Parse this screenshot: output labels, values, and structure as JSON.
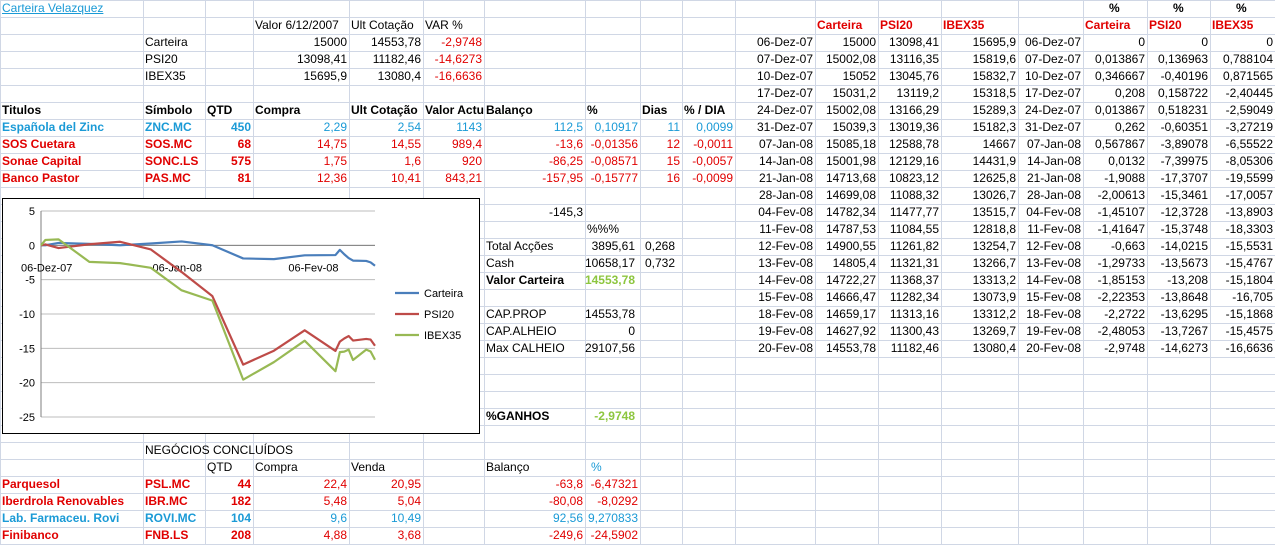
{
  "colors": {
    "red": "#e00000",
    "blue": "#1a9ad6",
    "green": "#8dc63f",
    "grid": "#d0d7e5"
  },
  "sheet": {
    "title": "Carteira Velazquez",
    "header": {
      "valor": "Valor 6/12/2007",
      "ult": "Ult Cotação",
      "var": "VAR %"
    },
    "summary": [
      {
        "label": "Carteira",
        "valor": "15000",
        "ult": "14553,78",
        "var": "-2,9748"
      },
      {
        "label": "PSI20",
        "valor": "13098,41",
        "ult": "11182,46",
        "var": "-14,6273"
      },
      {
        "label": "IBEX35",
        "valor": "15695,9",
        "ult": "13080,4",
        "var": "-16,6636"
      }
    ],
    "holdings_headers": [
      "Titulos",
      "Símbolo",
      "QTD",
      "Compra",
      "Ult Cotação",
      "Valor Actual",
      "Balanço",
      "%",
      "Dias",
      "% / DIA"
    ],
    "holdings": [
      {
        "name": "Española del Zinc",
        "symbol": "ZNC.MC",
        "qtd": "450",
        "compra": "2,29",
        "ult": "2,54",
        "valor": "1143",
        "balanco": "112,5",
        "pct": "0,10917",
        "dias": "11",
        "pctdia": "0,0099",
        "color": "blue"
      },
      {
        "name": "SOS Cuetara",
        "symbol": "SOS.MC",
        "qtd": "68",
        "compra": "14,75",
        "ult": "14,55",
        "valor": "989,4",
        "balanco": "-13,6",
        "pct": "-0,01356",
        "dias": "12",
        "pctdia": "-0,0011",
        "color": "red"
      },
      {
        "name": "Sonae Capital",
        "symbol": "SONC.LS",
        "qtd": "575",
        "compra": "1,75",
        "ult": "1,6",
        "valor": "920",
        "balanco": "-86,25",
        "pct": "-0,08571",
        "dias": "15",
        "pctdia": "-0,0057",
        "color": "red"
      },
      {
        "name": "Banco Pastor",
        "symbol": "PAS.MC",
        "qtd": "81",
        "compra": "12,36",
        "ult": "10,41",
        "valor": "843,21",
        "balanco": "-157,95",
        "pct": "-0,15777",
        "dias": "16",
        "pctdia": "-0,0099",
        "color": "red"
      }
    ],
    "balance_total": "-145,3",
    "pct_label": "%%%",
    "totals": [
      {
        "label": "Total Acções",
        "value": "3895,61",
        "pct": "0,268"
      },
      {
        "label": "Cash",
        "value": "10658,17",
        "pct": "0,732"
      }
    ],
    "valor_carteira": {
      "label": "Valor Carteira",
      "value": "14553,78"
    },
    "capital": [
      {
        "label": "CAP.PROP",
        "value": "14553,78"
      },
      {
        "label": "CAP.ALHEIO",
        "value": "0"
      },
      {
        "label": "Max CALHEIO",
        "value": "29107,56"
      }
    ],
    "ganhos": {
      "label": "%GANHOS",
      "value": "-2,9748"
    },
    "closed": {
      "title": "NEGÓCIOS CONCLUÍDOS",
      "headers": {
        "qtd": "QTD",
        "compra": "Compra",
        "venda": "Venda",
        "balanco": "Balanço",
        "pct": "%"
      },
      "rows": [
        {
          "name": "Parquesol",
          "symbol": "PSL.MC",
          "qtd": "44",
          "compra": "22,4",
          "venda": "20,95",
          "balanco": "-63,8",
          "pct": "-6,47321",
          "color": "red"
        },
        {
          "name": "Iberdrola Renovables",
          "symbol": "IBR.MC",
          "qtd": "182",
          "compra": "5,48",
          "venda": "5,04",
          "balanco": "-80,08",
          "pct": "-8,0292",
          "color": "red"
        },
        {
          "name": "Lab. Farmaceu. Rovi",
          "symbol": "ROVI.MC",
          "qtd": "104",
          "compra": "9,6",
          "venda": "10,49",
          "balanco": "92,56",
          "pct": "9,270833",
          "color": "blue"
        },
        {
          "name": "Finibanco",
          "symbol": "FNB.LS",
          "qtd": "208",
          "compra": "4,88",
          "venda": "3,68",
          "balanco": "-249,6",
          "pct": "-24,5902",
          "color": "red"
        }
      ]
    },
    "history_headers": [
      "Carteira",
      "PSI20",
      "IBEX35"
    ],
    "pct_headers": {
      "top": "%",
      "labels": [
        "Carteira",
        "PSI20",
        "IBEX35"
      ]
    },
    "history": [
      {
        "date": "06-Dez-07",
        "carteira": "15000",
        "psi20": "13098,41",
        "ibex35": "15695,9",
        "date2": "06-Dez-07",
        "pc": "0",
        "pp": "0",
        "pi": "0"
      },
      {
        "date": "07-Dez-07",
        "carteira": "15002,08",
        "psi20": "13116,35",
        "ibex35": "15819,6",
        "date2": "07-Dez-07",
        "pc": "0,013867",
        "pp": "0,136963",
        "pi": "0,788104"
      },
      {
        "date": "10-Dez-07",
        "carteira": "15052",
        "psi20": "13045,76",
        "ibex35": "15832,7",
        "date2": "10-Dez-07",
        "pc": "0,346667",
        "pp": "-0,40196",
        "pi": "0,871565"
      },
      {
        "date": "17-Dez-07",
        "carteira": "15031,2",
        "psi20": "13119,2",
        "ibex35": "15318,5",
        "date2": "17-Dez-07",
        "pc": "0,208",
        "pp": "0,158722",
        "pi": "-2,40445"
      },
      {
        "date": "24-Dez-07",
        "carteira": "15002,08",
        "psi20": "13166,29",
        "ibex35": "15289,3",
        "date2": "24-Dez-07",
        "pc": "0,013867",
        "pp": "0,518231",
        "pi": "-2,59049"
      },
      {
        "date": "31-Dez-07",
        "carteira": "15039,3",
        "psi20": "13019,36",
        "ibex35": "15182,3",
        "date2": "31-Dez-07",
        "pc": "0,262",
        "pp": "-0,60351",
        "pi": "-3,27219"
      },
      {
        "date": "07-Jan-08",
        "carteira": "15085,18",
        "psi20": "12588,78",
        "ibex35": "14667",
        "date2": "07-Jan-08",
        "pc": "0,567867",
        "pp": "-3,89078",
        "pi": "-6,55522"
      },
      {
        "date": "14-Jan-08",
        "carteira": "15001,98",
        "psi20": "12129,16",
        "ibex35": "14431,9",
        "date2": "14-Jan-08",
        "pc": "0,0132",
        "pp": "-7,39975",
        "pi": "-8,05306"
      },
      {
        "date": "21-Jan-08",
        "carteira": "14713,68",
        "psi20": "10823,12",
        "ibex35": "12625,8",
        "date2": "21-Jan-08",
        "pc": "-1,9088",
        "pp": "-17,3707",
        "pi": "-19,5599"
      },
      {
        "date": "28-Jan-08",
        "carteira": "14699,08",
        "psi20": "11088,32",
        "ibex35": "13026,7",
        "date2": "28-Jan-08",
        "pc": "-2,00613",
        "pp": "-15,3461",
        "pi": "-17,0057"
      },
      {
        "date": "04-Fev-08",
        "carteira": "14782,34",
        "psi20": "11477,77",
        "ibex35": "13515,7",
        "date2": "04-Fev-08",
        "pc": "-1,45107",
        "pp": "-12,3728",
        "pi": "-13,8903"
      },
      {
        "date": "11-Fev-08",
        "carteira": "14787,53",
        "psi20": "11084,55",
        "ibex35": "12818,8",
        "date2": "11-Fev-08",
        "pc": "-1,41647",
        "pp": "-15,3748",
        "pi": "-18,3303"
      },
      {
        "date": "12-Fev-08",
        "carteira": "14900,55",
        "psi20": "11261,82",
        "ibex35": "13254,7",
        "date2": "12-Fev-08",
        "pc": "-0,663",
        "pp": "-14,0215",
        "pi": "-15,5531"
      },
      {
        "date": "13-Fev-08",
        "carteira": "14805,4",
        "psi20": "11321,31",
        "ibex35": "13266,7",
        "date2": "13-Fev-08",
        "pc": "-1,29733",
        "pp": "-13,5673",
        "pi": "-15,4767"
      },
      {
        "date": "14-Fev-08",
        "carteira": "14722,27",
        "psi20": "11368,37",
        "ibex35": "13313,2",
        "date2": "14-Fev-08",
        "pc": "-1,85153",
        "pp": "-13,208",
        "pi": "-15,1804"
      },
      {
        "date": "15-Fev-08",
        "carteira": "14666,47",
        "psi20": "11282,34",
        "ibex35": "13073,9",
        "date2": "15-Fev-08",
        "pc": "-2,22353",
        "pp": "-13,8648",
        "pi": "-16,705"
      },
      {
        "date": "18-Fev-08",
        "carteira": "14659,17",
        "psi20": "11313,16",
        "ibex35": "13312,2",
        "date2": "18-Fev-08",
        "pc": "-2,2722",
        "pp": "-13,6295",
        "pi": "-15,1868"
      },
      {
        "date": "19-Fev-08",
        "carteira": "14627,92",
        "psi20": "11300,43",
        "ibex35": "13269,7",
        "date2": "19-Fev-08",
        "pc": "-2,48053",
        "pp": "-13,7267",
        "pi": "-15,4575"
      },
      {
        "date": "20-Fev-08",
        "carteira": "14553,78",
        "psi20": "11182,46",
        "ibex35": "13080,4",
        "date2": "20-Fev-08",
        "pc": "-2,9748",
        "pp": "-14,6273",
        "pi": "-16,6636"
      }
    ]
  },
  "chart_data": {
    "type": "line",
    "title": "",
    "xlabel": "",
    "ylabel": "",
    "ylim": [
      -25,
      5
    ],
    "yticks": [
      5,
      0,
      -5,
      -10,
      -15,
      -20,
      -25
    ],
    "x_tick_labels": [
      {
        "label": "06-Dez-07",
        "day": 0
      },
      {
        "label": "06-Jan-08",
        "day": 31
      },
      {
        "label": "06-Fev-08",
        "day": 62
      }
    ],
    "x": [
      "2007-12-06",
      "2007-12-07",
      "2007-12-10",
      "2007-12-17",
      "2007-12-24",
      "2007-12-31",
      "2008-01-07",
      "2008-01-14",
      "2008-01-21",
      "2008-01-28",
      "2008-02-04",
      "2008-02-11",
      "2008-02-12",
      "2008-02-13",
      "2008-02-14",
      "2008-02-15",
      "2008-02-18",
      "2008-02-19",
      "2008-02-20"
    ],
    "x_days": [
      0,
      1,
      4,
      11,
      18,
      25,
      32,
      39,
      46,
      53,
      60,
      67,
      68,
      69,
      70,
      71,
      74,
      75,
      76
    ],
    "legend_position": "right",
    "grid": true,
    "series": [
      {
        "name": "Carteira",
        "color": "#4a7ebb",
        "values": [
          0,
          0.014,
          0.347,
          0.208,
          0.014,
          0.262,
          0.568,
          0.013,
          -1.909,
          -2.006,
          -1.451,
          -1.416,
          -0.663,
          -1.297,
          -1.852,
          -2.224,
          -2.272,
          -2.481,
          -2.975
        ]
      },
      {
        "name": "PSI20",
        "color": "#be4b48",
        "values": [
          0,
          0.137,
          -0.402,
          0.159,
          0.518,
          -0.604,
          -3.891,
          -7.4,
          -17.371,
          -15.346,
          -12.373,
          -15.375,
          -14.022,
          -13.567,
          -13.208,
          -13.865,
          -13.63,
          -13.727,
          -14.627
        ]
      },
      {
        "name": "IBEX35",
        "color": "#98b954",
        "values": [
          0,
          0.788,
          0.872,
          -2.404,
          -2.59,
          -3.272,
          -6.555,
          -8.053,
          -19.56,
          -17.006,
          -13.89,
          -18.33,
          -15.553,
          -15.477,
          -15.18,
          -16.705,
          -15.187,
          -15.458,
          -16.664
        ]
      }
    ]
  }
}
